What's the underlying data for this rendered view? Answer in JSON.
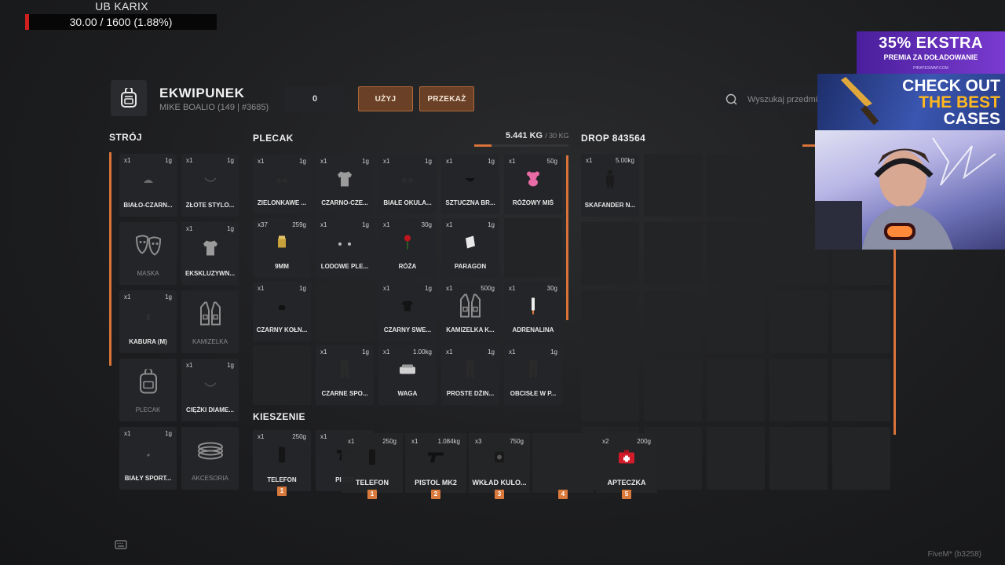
{
  "status": {
    "name": "UB KARIX",
    "value_text": "30.00 / 1600 (1.88%)",
    "fraction": 0.0188,
    "color": "#d01f1f"
  },
  "header": {
    "title": "EKWIPUNEK",
    "subtitle": "MIKE BOALIO (149 | #3685)",
    "amount": "0",
    "use_label": "UŻYJ",
    "give_label": "PRZEKAŻ",
    "search_placeholder": "Wyszukaj przedmiot"
  },
  "outfit": {
    "title": "STRÓJ",
    "slots": [
      {
        "qty": "x1",
        "weight": "1g",
        "label": "BIAŁO-CZARN...",
        "icon": "hat-icon"
      },
      {
        "qty": "x1",
        "weight": "1g",
        "label": "ZŁOTE STYLO...",
        "icon": "chain-icon"
      },
      {
        "qty": "",
        "weight": "",
        "label": "MASKA",
        "icon": "mask-icon"
      },
      {
        "qty": "x1",
        "weight": "1g",
        "label": "EKSKLUZYWN...",
        "icon": "shirt-icon"
      },
      {
        "qty": "x1",
        "weight": "1g",
        "label": "KABURA (M)",
        "icon": "holster-icon"
      },
      {
        "qty": "",
        "weight": "",
        "label": "KAMIZELKA",
        "icon": "vest-icon"
      },
      {
        "qty": "",
        "weight": "",
        "label": "PLECAK",
        "icon": "backpack-icon"
      },
      {
        "qty": "x1",
        "weight": "1g",
        "label": "CIĘŻKI DIAME...",
        "icon": "chain-icon"
      },
      {
        "qty": "x1",
        "weight": "1g",
        "label": "BIAŁY SPORT...",
        "icon": "watch-icon"
      },
      {
        "qty": "",
        "weight": "",
        "label": "AKCESORIA",
        "icon": "bracelet-icon"
      }
    ]
  },
  "backpack": {
    "title": "PLECAK",
    "weight_value": "5.441 KG",
    "weight_max": "/ 30 KG",
    "weight_fraction": 0.18,
    "slots": [
      {
        "qty": "x1",
        "weight": "1g",
        "label": "ZIELONKAWE ...",
        "icon": "glasses-icon"
      },
      {
        "qty": "x1",
        "weight": "1g",
        "label": "CZARNO-CZE...",
        "icon": "shirt-icon"
      },
      {
        "qty": "x1",
        "weight": "1g",
        "label": "BIAŁE OKULA...",
        "icon": "glasses-icon"
      },
      {
        "qty": "x1",
        "weight": "1g",
        "label": "SZTUCZNA BR...",
        "icon": "beard-icon"
      },
      {
        "qty": "x1",
        "weight": "50g",
        "label": "RÓŻOWY MIŚ",
        "icon": "teddy-icon"
      },
      {
        "qty": "x37",
        "weight": "259g",
        "label": "9MM",
        "icon": "ammo-icon"
      },
      {
        "qty": "x1",
        "weight": "1g",
        "label": "LODOWE PLE...",
        "icon": "earring-icon"
      },
      {
        "qty": "x1",
        "weight": "30g",
        "label": "RÓŻA",
        "icon": "rose-icon"
      },
      {
        "qty": "x1",
        "weight": "1g",
        "label": "PARAGON",
        "icon": "receipt-icon"
      },
      null,
      {
        "qty": "x1",
        "weight": "1g",
        "label": "CZARNY KOŁN...",
        "icon": "collar-icon"
      },
      null,
      {
        "qty": "x1",
        "weight": "1g",
        "label": "CZARNY SWE...",
        "icon": "sweater-icon"
      },
      {
        "qty": "x1",
        "weight": "500g",
        "label": "KAMIZELKA K...",
        "icon": "vest-icon"
      },
      {
        "qty": "x1",
        "weight": "30g",
        "label": "ADRENALINA",
        "icon": "syringe-icon"
      },
      null,
      {
        "qty": "x1",
        "weight": "1g",
        "label": "CZARNE SPO...",
        "icon": "pants-icon"
      },
      {
        "qty": "x1",
        "weight": "1.00kg",
        "label": "WAGA",
        "icon": "scale-icon"
      },
      {
        "qty": "x1",
        "weight": "1g",
        "label": "PROSTE DŻIN...",
        "icon": "pants-icon"
      },
      {
        "qty": "x1",
        "weight": "1g",
        "label": "OBCISŁE W P...",
        "icon": "pants-icon"
      }
    ]
  },
  "pockets": {
    "title": "KIESZENIE",
    "slots": [
      {
        "qty": "x1",
        "weight": "250g",
        "label": "TELEFON",
        "icon": "phone-icon",
        "hotkey": "1"
      },
      {
        "qty": "x1",
        "weight": "",
        "label": "PISTO",
        "icon": "pistol-icon",
        "hotkey": ""
      }
    ]
  },
  "hotbar": {
    "slots": [
      {
        "qty": "x1",
        "weight": "250g",
        "label": "TELEFON",
        "icon": "phone-icon",
        "hotkey": "1"
      },
      {
        "qty": "x1",
        "weight": "1.084kg",
        "label": "PISTOL MK2",
        "icon": "pistol-icon",
        "hotkey": "2"
      },
      {
        "qty": "x3",
        "weight": "750g",
        "label": "WKŁAD KULO...",
        "icon": "plate-icon",
        "hotkey": "3"
      },
      {
        "qty": "",
        "weight": "",
        "label": "",
        "icon": "",
        "hotkey": "4"
      },
      {
        "qty": "x2",
        "weight": "200g",
        "label": "APTECZKA",
        "icon": "medkit-icon",
        "hotkey": "5"
      }
    ]
  },
  "drop": {
    "title": "DROP 843564",
    "slots": [
      {
        "qty": "x1",
        "weight": "5.00kg",
        "label": "SKAFANDER N...",
        "icon": "suit-icon"
      }
    ]
  },
  "overlay": {
    "promo_main": "35% EKSTRA",
    "promo_sub": "PREMIA ZA DOŁADOWANIE",
    "promo_site": "PIRATESWAP.COM",
    "cases_line1": "CHECK OUT",
    "cases_line2": "THE BEST",
    "cases_line3": "CASES"
  },
  "footer": {
    "label": "FiveM* (b3258)"
  },
  "colors": {
    "accent": "#d9733a",
    "button_bg": "#6a4127",
    "slot_bg": "#242528"
  }
}
